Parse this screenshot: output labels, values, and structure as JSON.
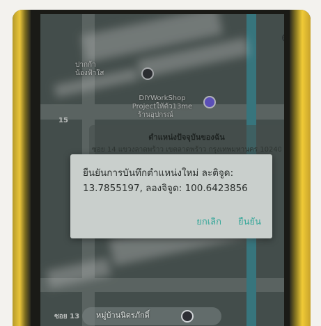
{
  "map": {
    "place_1": "ปากก้า\nน้องฟ้าใส",
    "place_2": "DIYWorkShop\nProjectให้ต้ว13me",
    "place_2_sub": "ร้านอุปกรณ์",
    "place_3": "หมู่บ้านนิตรภักดิ์",
    "road_1": "15",
    "road_2": "ซอย 13",
    "locate_icon": "crosshair-icon"
  },
  "location_card": {
    "title": "ตำแหน่งปัจจุบันของฉัน",
    "address": "ซอย 14 แขวงลาดพร้าว เขตลาดพร้าว กรุงเทพมหานคร 10240"
  },
  "dialog": {
    "message": "ยืนยันการบันทึกตำแหน่งใหม่ ละติจูด: 13.7855197, ลองจิจูด: 100.6423856",
    "cancel_label": "ยกเลิก",
    "confirm_label": "ยืนยัน"
  },
  "colors": {
    "accent": "#37a79a",
    "dialog_bg": "#c9cfcc",
    "device_frame": "#e9c53a"
  }
}
